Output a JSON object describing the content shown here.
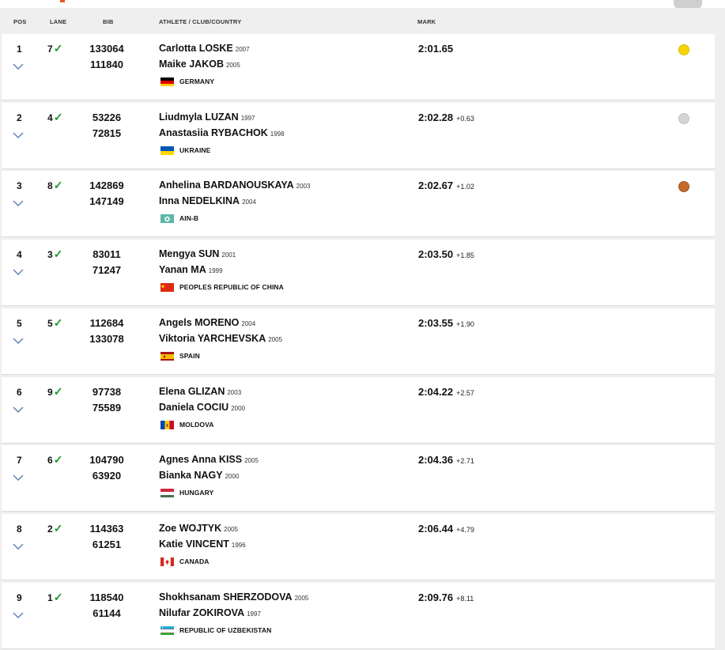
{
  "header": {
    "pos": "POS",
    "lane": "LANE",
    "bib": "BIB",
    "athlete": "ATHLETE / CLUB/COUNTRY",
    "mark": "MARK"
  },
  "colors": {
    "check": "#1a9a2a",
    "gold": "#f5d400",
    "silver": "#d4d4d4",
    "bronze": "#c46a2a"
  },
  "rows": [
    {
      "pos": "1",
      "lane": "7",
      "check": "✓",
      "bib1": "133064",
      "bib2": "111840",
      "athlete1": "Carlotta LOSKE",
      "year1": "2007",
      "athlete2": "Maike JAKOB",
      "year2": "2005",
      "country": "GERMANY",
      "flag": "germany-flag",
      "mark": "2:01.65",
      "diff": "",
      "medal": "gold"
    },
    {
      "pos": "2",
      "lane": "4",
      "check": "✓",
      "bib1": "53226",
      "bib2": "72815",
      "athlete1": "Liudmyla LUZAN",
      "year1": "1997",
      "athlete2": "Anastasiia RYBACHOK",
      "year2": "1998",
      "country": "UKRAINE",
      "flag": "ukraine-flag",
      "mark": "2:02.28",
      "diff": "+0.63",
      "medal": "silver"
    },
    {
      "pos": "3",
      "lane": "8",
      "check": "✓",
      "bib1": "142869",
      "bib2": "147149",
      "athlete1": "Anhelina BARDANOUSKAYA",
      "year1": "2003",
      "athlete2": "Inna NEDELKINA",
      "year2": "2004",
      "country": "AIN-B",
      "flag": "ain-flag",
      "mark": "2:02.67",
      "diff": "+1.02",
      "medal": "bronze"
    },
    {
      "pos": "4",
      "lane": "3",
      "check": "✓",
      "bib1": "83011",
      "bib2": "71247",
      "athlete1": "Mengya SUN",
      "year1": "2001",
      "athlete2": "Yanan MA",
      "year2": "1999",
      "country": "PEOPLES REPUBLIC OF CHINA",
      "flag": "china-flag",
      "mark": "2:03.50",
      "diff": "+1.85",
      "medal": ""
    },
    {
      "pos": "5",
      "lane": "5",
      "check": "✓",
      "bib1": "112684",
      "bib2": "133078",
      "athlete1": "Angels MORENO",
      "year1": "2004",
      "athlete2": "Viktoria YARCHEVSKA",
      "year2": "2005",
      "country": "SPAIN",
      "flag": "spain-flag",
      "mark": "2:03.55",
      "diff": "+1.90",
      "medal": ""
    },
    {
      "pos": "6",
      "lane": "9",
      "check": "✓",
      "bib1": "97738",
      "bib2": "75589",
      "athlete1": "Elena GLIZAN",
      "year1": "2003",
      "athlete2": "Daniela COCIU",
      "year2": "2000",
      "country": "MOLDOVA",
      "flag": "moldova-flag",
      "mark": "2:04.22",
      "diff": "+2.57",
      "medal": ""
    },
    {
      "pos": "7",
      "lane": "6",
      "check": "✓",
      "bib1": "104790",
      "bib2": "63920",
      "athlete1": "Agnes Anna KISS",
      "year1": "2005",
      "athlete2": "Bianka NAGY",
      "year2": "2000",
      "country": "HUNGARY",
      "flag": "hungary-flag",
      "mark": "2:04.36",
      "diff": "+2.71",
      "medal": ""
    },
    {
      "pos": "8",
      "lane": "2",
      "check": "✓",
      "bib1": "114363",
      "bib2": "61251",
      "athlete1": "Zoe WOJTYK",
      "year1": "2005",
      "athlete2": "Katie VINCENT",
      "year2": "1996",
      "country": "CANADA",
      "flag": "canada-flag",
      "mark": "2:06.44",
      "diff": "+4.79",
      "medal": ""
    },
    {
      "pos": "9",
      "lane": "1",
      "check": "✓",
      "bib1": "118540",
      "bib2": "61144",
      "athlete1": "Shokhsanam SHERZODOVA",
      "year1": "2005",
      "athlete2": "Nilufar ZOKIROVA",
      "year2": "1997",
      "country": "REPUBLIC OF UZBEKISTAN",
      "flag": "uzbekistan-flag",
      "mark": "2:09.76",
      "diff": "+8.11",
      "medal": ""
    }
  ]
}
